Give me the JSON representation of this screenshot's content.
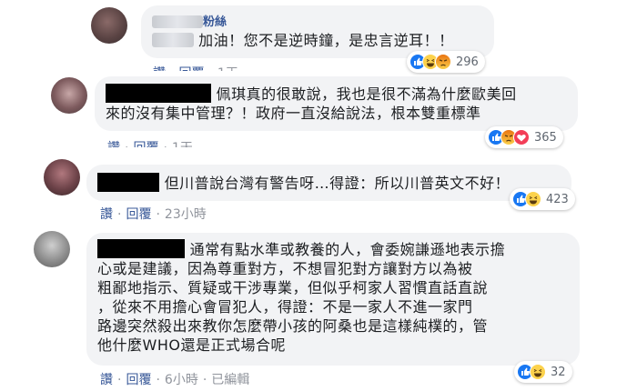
{
  "comments": [
    {
      "name_suffix": "粉絲",
      "text": "加油！您不是逆時鐘，是忠言逆耳！！",
      "actions": {
        "like": "讚",
        "reply": "回覆",
        "time": "1天"
      },
      "reactions": {
        "icons": [
          "like-icon",
          "haha-icon",
          "angry-icon"
        ],
        "count": "296"
      }
    },
    {
      "text_lines": [
        "佩琪真的很敢說，我也是很不滿為什麼歐美回",
        "來的沒有集中管理？！政府一直沒給說法，根本雙重標準"
      ],
      "actions": {
        "like": "讚",
        "reply": "回覆",
        "time": "1天"
      },
      "reactions": {
        "icons": [
          "like-icon",
          "angry-icon",
          "love-icon"
        ],
        "count": "365"
      }
    },
    {
      "text": "但川普說台灣有警告呀…得證：所以川普英文不好！",
      "actions": {
        "like": "讚",
        "reply": "回覆",
        "time": "23小時"
      },
      "reactions": {
        "icons": [
          "like-icon",
          "haha-icon"
        ],
        "count": "423"
      }
    },
    {
      "text_lines": [
        "通常有點水準或教養的人，會委婉謙遜地表示擔",
        "心或是建議，因為尊重對方，不想冒犯對方讓對方以為被",
        "粗鄙地指示、質疑或干涉專業，但似乎柯家人習慣直話直說",
        "，從來不用擔心會冒犯人，得證：不是一家人不進一家門",
        "路邊突然殺出來教你怎麼帶小孩的阿桑也是這樣純樸的，管",
        "他什麼WHO還是正式場合呢"
      ],
      "actions": {
        "like": "讚",
        "reply": "回覆",
        "time": "6小時",
        "edited": "已編輯"
      },
      "reactions": {
        "icons": [
          "like-icon",
          "haha-icon"
        ],
        "count": "32"
      }
    }
  ],
  "colors": {
    "link": "#385898",
    "meta": "#90949c",
    "bubble": "#f2f3f5",
    "like": "#1877f2",
    "angry": "#e9710f",
    "love": "#f33e58"
  }
}
